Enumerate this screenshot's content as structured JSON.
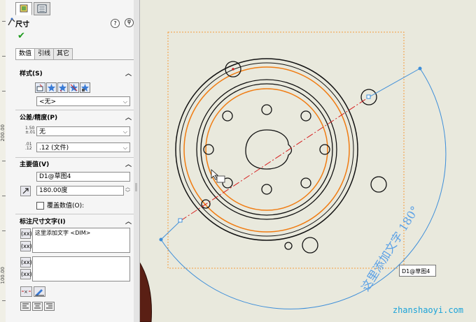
{
  "ruler": {
    "top_label": "200.00",
    "bottom_label": "100.00"
  },
  "panel": {
    "title": "尺寸",
    "help_label": "?",
    "tabs": [
      "数值",
      "引线",
      "其它"
    ],
    "style_section": {
      "title": "样式(S)",
      "combo_value": "<无>"
    },
    "tolerance_section": {
      "title": "公差/精度(P)",
      "tolerance_icon_text": "1.50 ±.01",
      "tolerance_value": "无",
      "precision_icon_text": ".01 .12",
      "precision_value": ".12 (文件)"
    },
    "primary_section": {
      "title": "主要值(V)",
      "name_value": "D1@草图4",
      "angle_value": "180.00度",
      "override_label": "覆盖数值(O):"
    },
    "dimension_text_section": {
      "title": "标注尺寸文字(I)",
      "text_value": "这里添加文字 <DIM>",
      "btn_symbol_1": "(xx)",
      "btn_symbol_2": "(xx)",
      "btn_symbol_3": "(xx)",
      "btn_symbol_4": "(xx)"
    }
  },
  "canvas": {
    "dimension_annotation": "这里添加文字 180°",
    "tooltip": "D1@草图4",
    "watermark": "zhanshaoyi.com"
  },
  "colors": {
    "sketch_black": "#111111",
    "orange_circle": "#f07c12",
    "dimension_blue": "#3d8ed9",
    "centerline_red": "#d62020",
    "bbox_orange": "#f59a3c"
  }
}
